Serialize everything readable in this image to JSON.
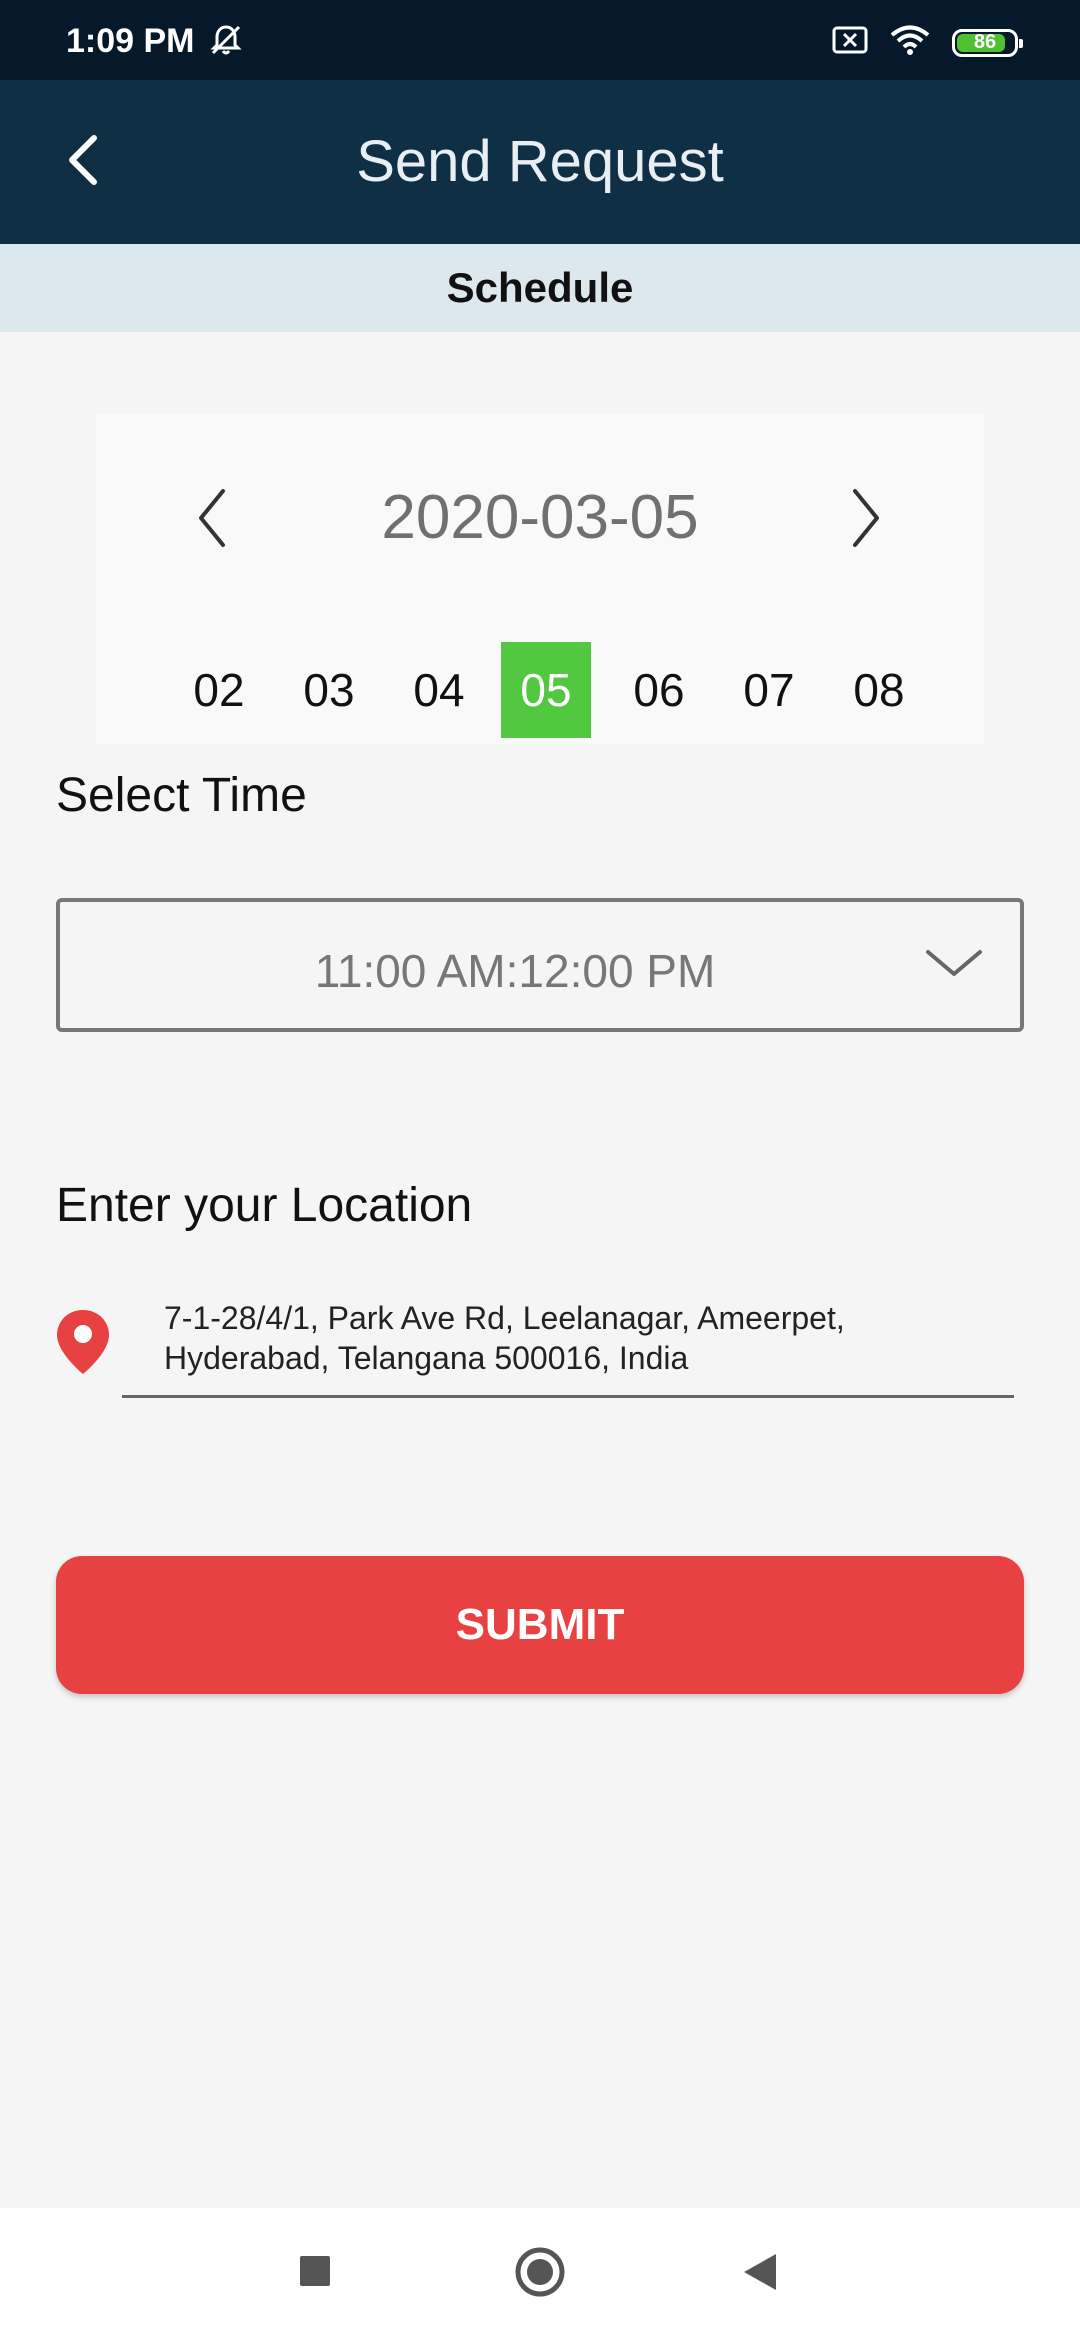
{
  "status_bar": {
    "time": "1:09 PM",
    "battery": "86",
    "battery_level": 0.86,
    "icons": [
      "mute-icon",
      "sim-x-icon",
      "wifi-icon",
      "battery-icon"
    ]
  },
  "app_bar": {
    "title": "Send Request",
    "back_icon": "chevron-left-icon"
  },
  "section": {
    "title": "Schedule"
  },
  "date_picker": {
    "current_date": "2020-03-05",
    "days": [
      "02",
      "03",
      "04",
      "05",
      "06",
      "07",
      "08"
    ],
    "selected_day": "05",
    "selected_color": "#51c83f"
  },
  "time": {
    "label": "Select Time",
    "selected": "11:00 AM:12:00 PM"
  },
  "location": {
    "label": "Enter your Location",
    "line1": "7-1-28/4/1, Park Ave Rd, Leelanagar, Ameerpet,",
    "line2": "Hyderabad, Telangana 500016, India"
  },
  "submit": {
    "label": "SUBMIT",
    "color": "#e84141"
  },
  "colors": {
    "header": "#0e2f44",
    "status_bar": "#06192a",
    "section_header": "#dde7ee"
  }
}
